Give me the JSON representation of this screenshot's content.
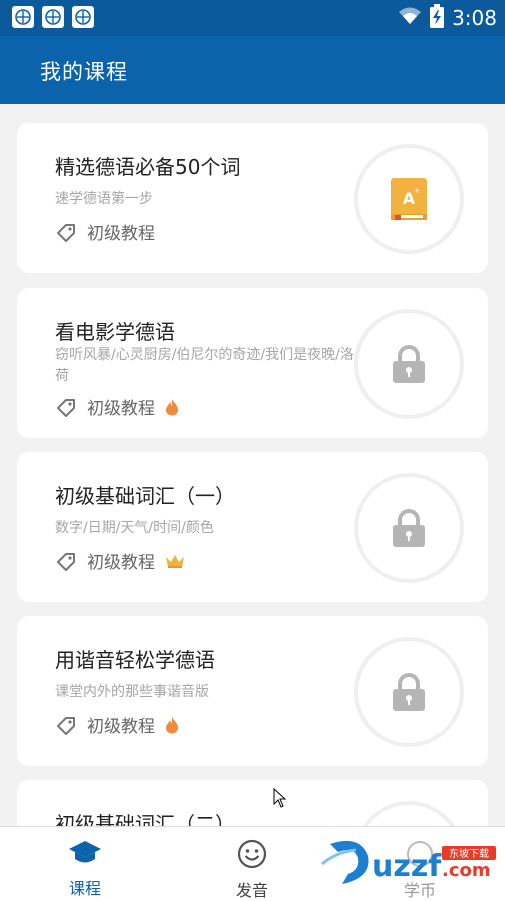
{
  "status_bar": {
    "time": "3:08",
    "icons": [
      "app-badge-icon",
      "app-badge-icon",
      "app-badge-icon",
      "wifi-icon",
      "battery-charging-icon"
    ]
  },
  "header": {
    "title": "我的课程"
  },
  "courses": [
    {
      "title": "精选德语必备50个词",
      "subtitle": "速学德语第一步",
      "level": "初级教程",
      "status": "unlocked",
      "badge": ""
    },
    {
      "title": "看电影学德语",
      "subtitle": "窃听风暴/心灵厨房/伯尼尔的奇迹/我们是夜晚/洛荷",
      "level": "初级教程",
      "status": "locked",
      "badge": "fire-icon"
    },
    {
      "title": "初级基础词汇（一）",
      "subtitle": "数字/日期/天气/时间/颜色",
      "level": "初级教程",
      "status": "locked",
      "badge": "crown-icon"
    },
    {
      "title": "用谐音轻松学德语",
      "subtitle": "课堂内外的那些事谐音版",
      "level": "初级教程",
      "status": "locked",
      "badge": "fire-icon"
    },
    {
      "title": "初级基础词汇（二）",
      "status": "locked"
    }
  ],
  "bottom_nav": {
    "items": [
      {
        "label": "课程",
        "icon": "graduation-cap-icon",
        "active": true
      },
      {
        "label": "发音",
        "icon": "smiley-icon",
        "active": false
      },
      {
        "label": "学币",
        "icon": "coin-icon",
        "active": false
      }
    ]
  },
  "watermark": {
    "brand": "uzzf.com",
    "tag": "东坡下载"
  },
  "colors": {
    "primary": "#0b63ab",
    "status_bar": "#0a5a9c",
    "background": "#f2f2f2",
    "title_text": "#222222",
    "subtitle_text": "#a6a6a6",
    "level_text": "#666666",
    "fire": "#f08a3c",
    "crown": "#f3b03d",
    "book": "#f2b23f",
    "lock": "#b5b5b5"
  }
}
